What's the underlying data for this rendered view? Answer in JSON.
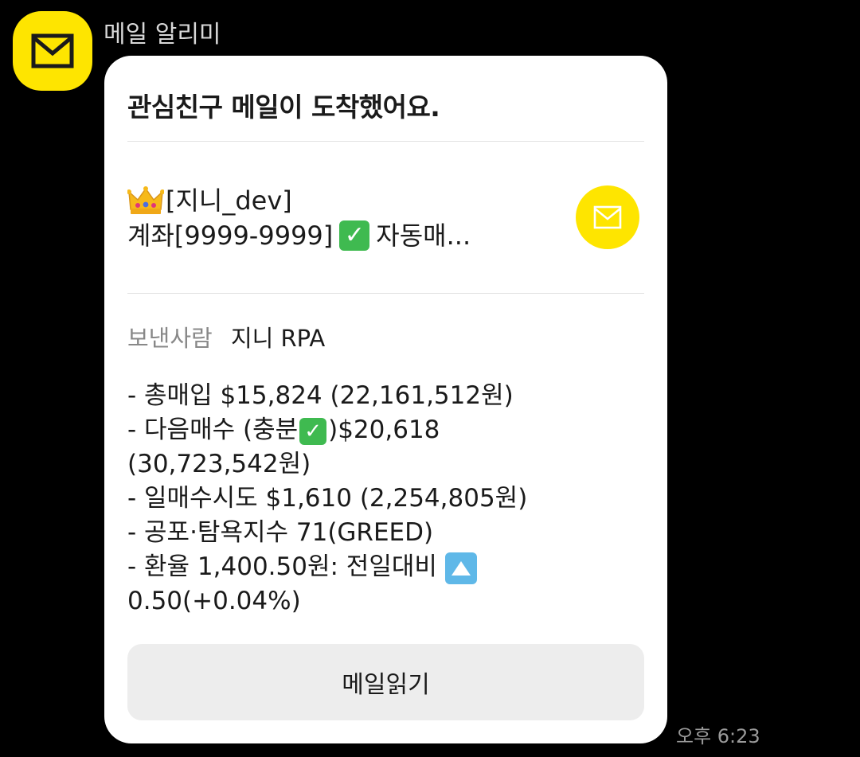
{
  "sender": {
    "name": "메일 알리미",
    "avatar_icon": "envelope-icon",
    "avatar_color": "#FEE500"
  },
  "card": {
    "title": "관심친구 메일이 도착했어요.",
    "subject_line1": "[지니_dev]",
    "subject_line2_prefix": "계좌[9999-9999]",
    "subject_line2_suffix": "자동매...",
    "subject_emojis": [
      "crown-emoji",
      "check-mark-emoji"
    ],
    "mail_icon": "envelope-icon",
    "sender_label": "보낸사람",
    "sender_value": "지니 RPA",
    "body": {
      "line1": "- 총매입 $15,824 (22,161,512원)",
      "line2_prefix": "- 다음매수 (충분",
      "line2_suffix": ")$20,618",
      "line3": "(30,723,542원)",
      "line4": "- 일매수시도 $1,610 (2,254,805원)",
      "line5": "- 공포·탐욕지수 71(GREED)",
      "line6": "- 환율 1,400.50원: 전일대비",
      "line7": "0.50(+0.04%)"
    },
    "read_button_label": "메일읽기"
  },
  "timestamp": "오후 6:23",
  "colors": {
    "background": "#000000",
    "card": "#FFFFFF",
    "accent_yellow": "#FEE500",
    "button_bg": "#EDEDED",
    "check_green": "#3FBA50",
    "up_blue": "#5FB8E8"
  }
}
